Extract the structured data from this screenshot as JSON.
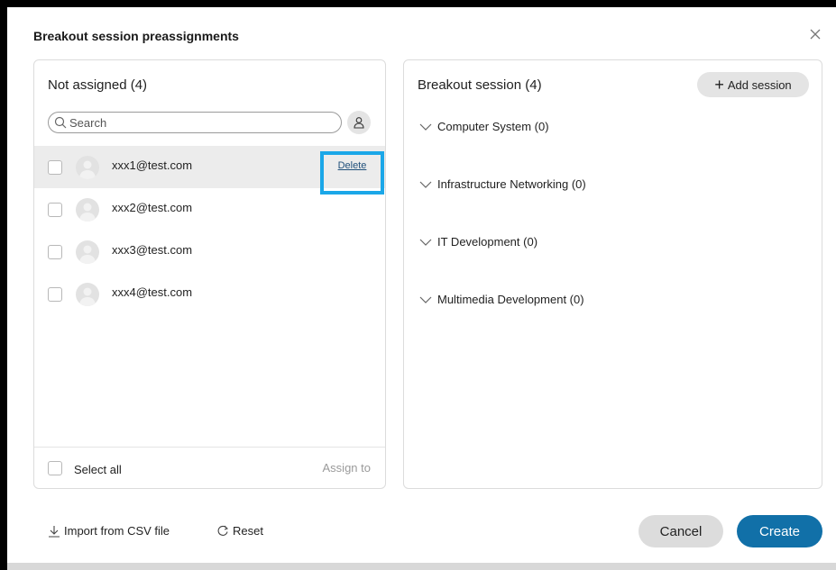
{
  "dialog": {
    "title": "Breakout session preassignments"
  },
  "left_panel": {
    "heading": "Not assigned (4)",
    "search_placeholder": "Search",
    "users": [
      {
        "email": "xxx1@test.com",
        "selected": true
      },
      {
        "email": "xxx2@test.com",
        "selected": false
      },
      {
        "email": "xxx3@test.com",
        "selected": false
      },
      {
        "email": "xxx4@test.com",
        "selected": false
      }
    ],
    "delete_label": "Delete",
    "select_all_label": "Select all",
    "assign_to_label": "Assign to"
  },
  "right_panel": {
    "heading": "Breakout session (4)",
    "add_session_label": "Add session",
    "sessions": [
      {
        "label": "Computer System (0)"
      },
      {
        "label": "Infrastructure Networking (0)"
      },
      {
        "label": "IT Development (0)"
      },
      {
        "label": "Multimedia Development (0)"
      }
    ]
  },
  "footer": {
    "import_label": "Import from CSV file",
    "reset_label": "Reset",
    "cancel_label": "Cancel",
    "create_label": "Create"
  },
  "colors": {
    "primary": "#1170a8",
    "highlight": "#1ba7e8",
    "selected_row": "#ececec"
  }
}
